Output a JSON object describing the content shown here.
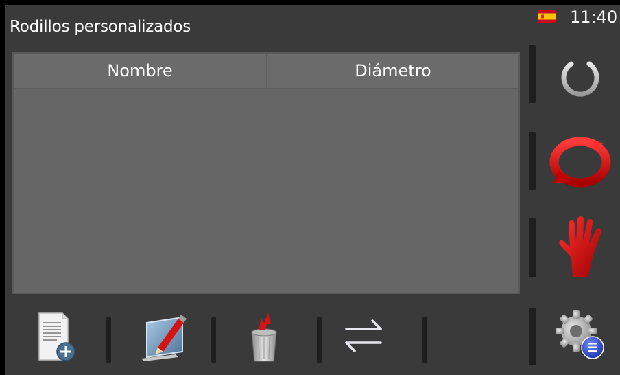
{
  "header": {
    "title": "Rodillos personalizados",
    "time": "11:40",
    "language_flag": "spain-flag-icon"
  },
  "table": {
    "columns": [
      "Nombre",
      "Diámetro"
    ],
    "rows": []
  },
  "sidebar": {
    "buttons": [
      {
        "name": "power-button",
        "icon": "power-icon"
      },
      {
        "name": "reset-cycle-button",
        "icon": "red-rotation-icon"
      },
      {
        "name": "stop-hand-button",
        "icon": "red-hand-icon"
      },
      {
        "name": "settings-button",
        "icon": "gear-list-icon"
      }
    ]
  },
  "toolbar": {
    "buttons": [
      {
        "name": "add-roller-button",
        "icon": "document-add-icon"
      },
      {
        "name": "edit-roller-button",
        "icon": "pencil-edit-icon"
      },
      {
        "name": "delete-roller-button",
        "icon": "trash-can-icon"
      },
      {
        "name": "transfer-button",
        "icon": "swap-arrows-icon"
      }
    ]
  },
  "colors": {
    "background": "#3a3a3a",
    "panel": "#666666",
    "accent_red": "#d41414",
    "text": "#ffffff"
  }
}
